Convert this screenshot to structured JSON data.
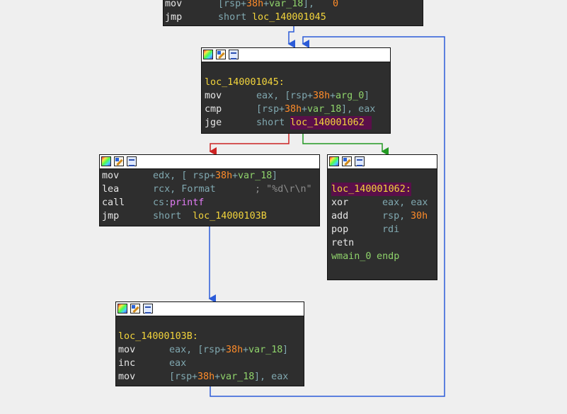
{
  "colors": {
    "edge_false": "#cc2222",
    "edge_true": "#229922",
    "edge_jump": "#2b5bd8",
    "node_bg": "#2e2e2e",
    "canvas_bg": "#efefef"
  },
  "icons": [
    "palette-icon",
    "rename-icon",
    "graph-icon"
  ],
  "nodes": {
    "top": {
      "l0": {
        "mn": "mov",
        "a": "[",
        "b": "rsp",
        "c": "+",
        "d": "38h",
        "e": "+",
        "f": "var_18",
        "g": "], ",
        "h": "0"
      },
      "l1": {
        "mn": "jmp",
        "a": "short ",
        "b": "loc_140001045"
      }
    },
    "cmp": {
      "label": "loc_140001045:",
      "l1": {
        "mn": "mov",
        "a": "eax, [",
        "b": "rsp",
        "c": "+",
        "d": "38h",
        "e": "+",
        "f": "arg_0",
        "g": "]"
      },
      "l2": {
        "mn": "cmp",
        "a": "[",
        "b": "rsp",
        "c": "+",
        "d": "38h",
        "e": "+",
        "f": "var_18",
        "g": "], eax"
      },
      "l3": {
        "mn": "jge",
        "a": "short ",
        "b": "loc_140001062"
      }
    },
    "print": {
      "l0": {
        "mn": "mov",
        "a": "edx, [",
        "b": "rsp",
        "c": "+",
        "d": "38h",
        "e": "+",
        "f": "var_18",
        "g": "]"
      },
      "l1": {
        "mn": "lea",
        "a": "rcx, Format",
        "cm": "; \"%d\\r\\n\""
      },
      "l2": {
        "mn": "call",
        "a": "cs:",
        "b": "printf"
      },
      "l3": {
        "mn": "jmp",
        "a": "short ",
        "b": "loc_14000103B"
      }
    },
    "ret": {
      "label": "loc_140001062:",
      "l1": {
        "mn": "xor",
        "a": "eax, eax"
      },
      "l2": {
        "mn": "add",
        "a": "rsp, ",
        "b": "30h"
      },
      "l3": {
        "mn": "pop",
        "a": "rdi"
      },
      "l4": {
        "mn": "retn"
      },
      "l5": {
        "a": "wmain_0",
        "b": " endp"
      }
    },
    "inc": {
      "label": "loc_14000103B:",
      "l1": {
        "mn": "mov",
        "a": "eax, [",
        "b": "rsp",
        "c": "+",
        "d": "38h",
        "e": "+",
        "f": "var_18",
        "g": "]"
      },
      "l2": {
        "mn": "inc",
        "a": "eax"
      },
      "l3": {
        "mn": "mov",
        "a": "[",
        "b": "rsp",
        "c": "+",
        "d": "38h",
        "e": "+",
        "f": "var_18",
        "g": "], eax"
      }
    }
  }
}
